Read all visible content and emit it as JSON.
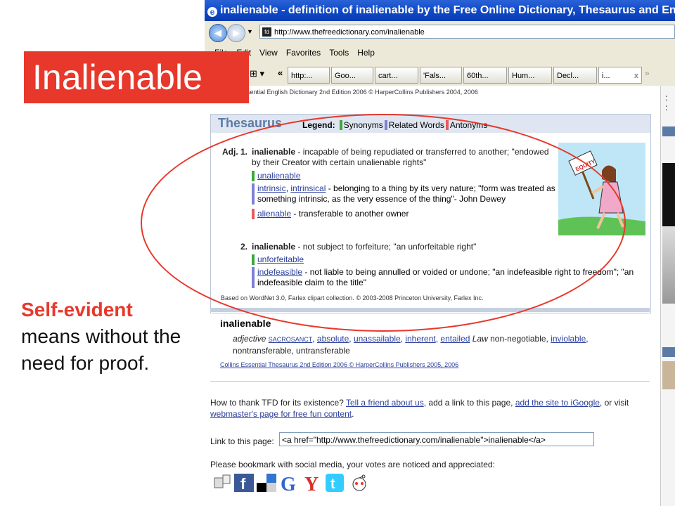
{
  "slide": {
    "title": "Inalienable",
    "side_highlight": "Self-evident",
    "side_rest": " means without the need for proof."
  },
  "browser": {
    "window_title": "inalienable - definition of inalienable by the Free Online Dictionary, Thesaurus and Encyclopedia.",
    "address": "http://www.thefreedictionary.com/inalienable",
    "menu": [
      "File",
      "Edit",
      "View",
      "Favorites",
      "Tools",
      "Help"
    ],
    "tabs": [
      "http:...",
      "Goo...",
      "cart...",
      "'Fals...",
      "60th...",
      "Hum...",
      "Decl...",
      "i..."
    ],
    "tab_more": "»"
  },
  "page": {
    "credit_collins_dict": "Collins Essential English Dictionary 2nd Edition 2006 © HarperCollins Publishers 2004, 2006",
    "thesaurus": {
      "title": "Thesaurus",
      "legend_label": "Legend:",
      "legend_syn": "Synonyms",
      "legend_rel": "Related Words",
      "legend_ant": "Antonyms",
      "sense1_num": "Adj. 1.",
      "sense1_word": "inalienable",
      "sense1_def": " - incapable of being repudiated or transferred to another; \"endowed by their Creator with certain unalienable rights\"",
      "sense1_syn1": "unalienable",
      "sense1_rel_link1": "intrinsic",
      "sense1_rel_link2": "intrinsical",
      "sense1_rel_def": " - belonging to a thing by its very nature; \"form was treated as something intrinsic, as the very essence of the thing\"- John Dewey",
      "sense1_ant_link": "alienable",
      "sense1_ant_def": " - transferable to another owner",
      "sense2_num": "2.",
      "sense2_word": "inalienable",
      "sense2_def": " - not subject to forfeiture; \"an unforfeitable right\"",
      "sense2_syn1": "unforfeitable",
      "sense2_rel_link": "indefeasible",
      "sense2_rel_def": " - not liable to being annulled or voided or undone; \"an indefeasible right to freedom\"; \"an indefeasible claim to the title\"",
      "footer": "Based on WordNet 3.0, Farlex clipart collection. © 2003-2008 Princeton University, Farlex Inc.",
      "sign_text": "EQUITY"
    },
    "collins": {
      "headword": "inalienable",
      "pos": "adjective",
      "syn_caps": "SACROSANCT",
      "syns": [
        "absolute",
        "unassailable",
        "inherent",
        "entailed"
      ],
      "law_label": "Law",
      "law_text": " non-negotiable, ",
      "syn_last": "inviolable",
      "tail": ", nontransferable, untransferable",
      "credit": "Collins Essential Thesaurus 2nd Edition 2006 © HarperCollins Publishers 2005, 2006"
    },
    "thank": {
      "prefix": "How to thank TFD for its existence? ",
      "link1": "Tell a friend about us",
      "mid": ", add a link to this page, ",
      "link2": "add the site to iGoogle",
      "mid2": ", or visit ",
      "link3": "webmaster's page for free fun content",
      "end": "."
    },
    "link_label": "Link to this page:",
    "link_value": "<a href=\"http://www.thefreedictionary.com/inalienable\">inalienable</a>",
    "bookmark_text": "Please bookmark with social media, your votes are noticed and appreciated:"
  }
}
